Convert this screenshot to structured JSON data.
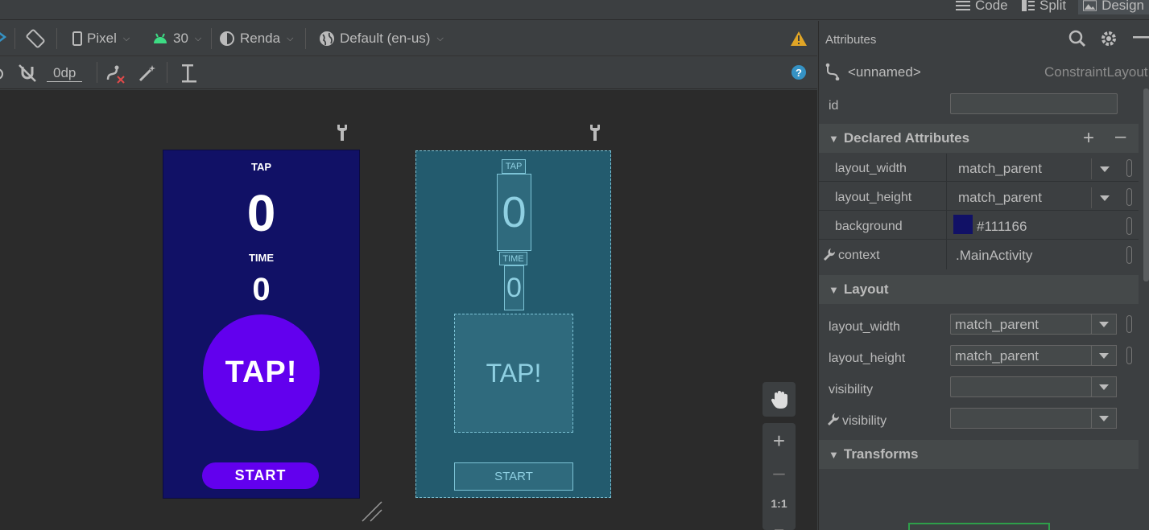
{
  "modes": {
    "code": "Code",
    "split": "Split",
    "design": "Design"
  },
  "toolbar": {
    "device": "Pixel",
    "api": "30",
    "render": "Renda",
    "locale": "Default (en-us)",
    "margin": "0dp"
  },
  "preview": {
    "tap_label": "TAP",
    "count": "0",
    "time_label": "TIME",
    "time_value": "0",
    "tap_button": "TAP!",
    "start_button": "START"
  },
  "blueprint": {
    "tap_label": "TAP",
    "count": "0",
    "time_label": "TIME",
    "time_value": "0",
    "tap_button": "TAP!",
    "start_button": "START"
  },
  "zoom": {
    "reset": "1:1"
  },
  "attributes": {
    "title": "Attributes",
    "component_name": "<unnamed>",
    "component_type": "ConstraintLayout",
    "id_label": "id",
    "id_value": "",
    "declared": {
      "title": "Declared Attributes",
      "rows": [
        {
          "name": "layout_width",
          "value": "match_parent"
        },
        {
          "name": "layout_height",
          "value": "match_parent"
        },
        {
          "name": "background",
          "value": "#111166"
        },
        {
          "name": "context",
          "value": ".MainActivity"
        }
      ]
    },
    "layout": {
      "title": "Layout",
      "rows": [
        {
          "name": "layout_width",
          "value": "match_parent"
        },
        {
          "name": "layout_height",
          "value": "match_parent"
        },
        {
          "name": "visibility",
          "value": ""
        },
        {
          "name": "visibility",
          "value": ""
        }
      ]
    },
    "transforms": {
      "title": "Transforms"
    }
  },
  "colors": {
    "background_swatch": "#111166",
    "tap_button": "#6200ee",
    "blueprint": "#235b6e",
    "warning": "#e0a526",
    "help": "#3592c4"
  }
}
